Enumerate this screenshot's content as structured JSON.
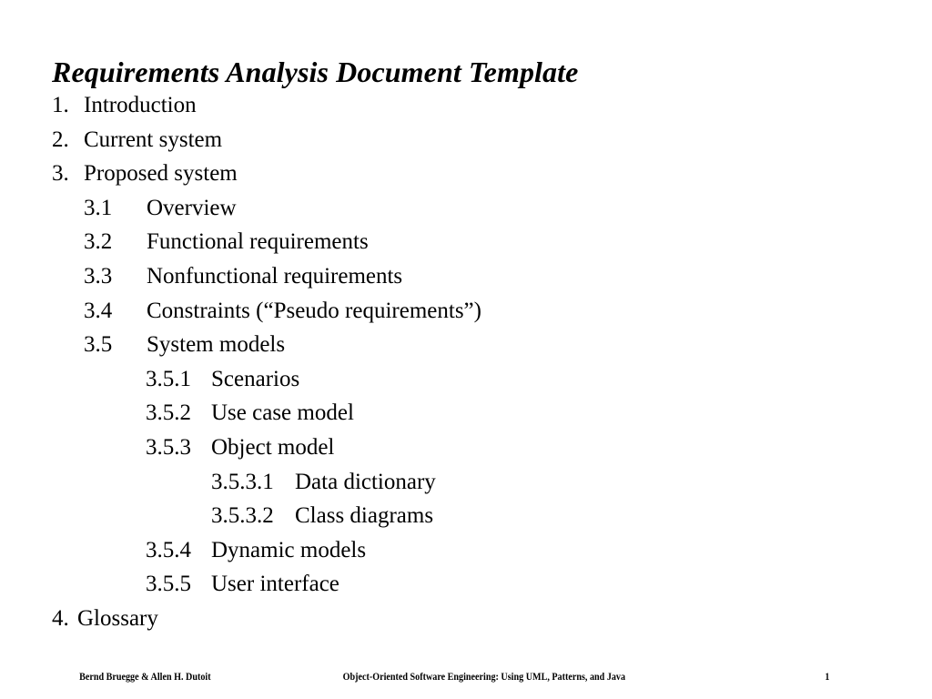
{
  "slide": {
    "title": "Requirements Analysis Document Template",
    "outline": [
      {
        "level": 1,
        "number": "1.",
        "label": "Introduction"
      },
      {
        "level": 1,
        "number": "2.",
        "label": "Current system"
      },
      {
        "level": 1,
        "number": "3.",
        "label": "Proposed system"
      },
      {
        "level": 2,
        "number": "3.1",
        "label": "Overview"
      },
      {
        "level": 2,
        "number": "3.2",
        "label": "Functional requirements"
      },
      {
        "level": 2,
        "number": "3.3",
        "label": "Nonfunctional requirements"
      },
      {
        "level": 2,
        "number": "3.4",
        "label": "Constraints (“Pseudo requirements”)"
      },
      {
        "level": 2,
        "number": "3.5",
        "label": "System models"
      },
      {
        "level": 3,
        "number": "3.5.1",
        "label": "Scenarios"
      },
      {
        "level": 3,
        "number": "3.5.2",
        "label": "Use case model"
      },
      {
        "level": 3,
        "number": "3.5.3",
        "label": "Object model"
      },
      {
        "level": 4,
        "number": "3.5.3.1",
        "label": "Data dictionary"
      },
      {
        "level": 4,
        "number": "3.5.3.2",
        "label": "Class diagrams"
      },
      {
        "level": 3,
        "number": "3.5.4",
        "label": "Dynamic models"
      },
      {
        "level": 3,
        "number": "3.5.5",
        "label": "User interface"
      },
      {
        "level": 5,
        "number": "4.",
        "label": "Glossary"
      }
    ]
  },
  "footer": {
    "authors": "Bernd Bruegge & Allen H. Dutoit",
    "book_title": "Object-Oriented Software Engineering: Using UML, Patterns, and Java",
    "page_number": "1"
  },
  "colors": {
    "background": "#ffffff",
    "text": "#000000"
  }
}
